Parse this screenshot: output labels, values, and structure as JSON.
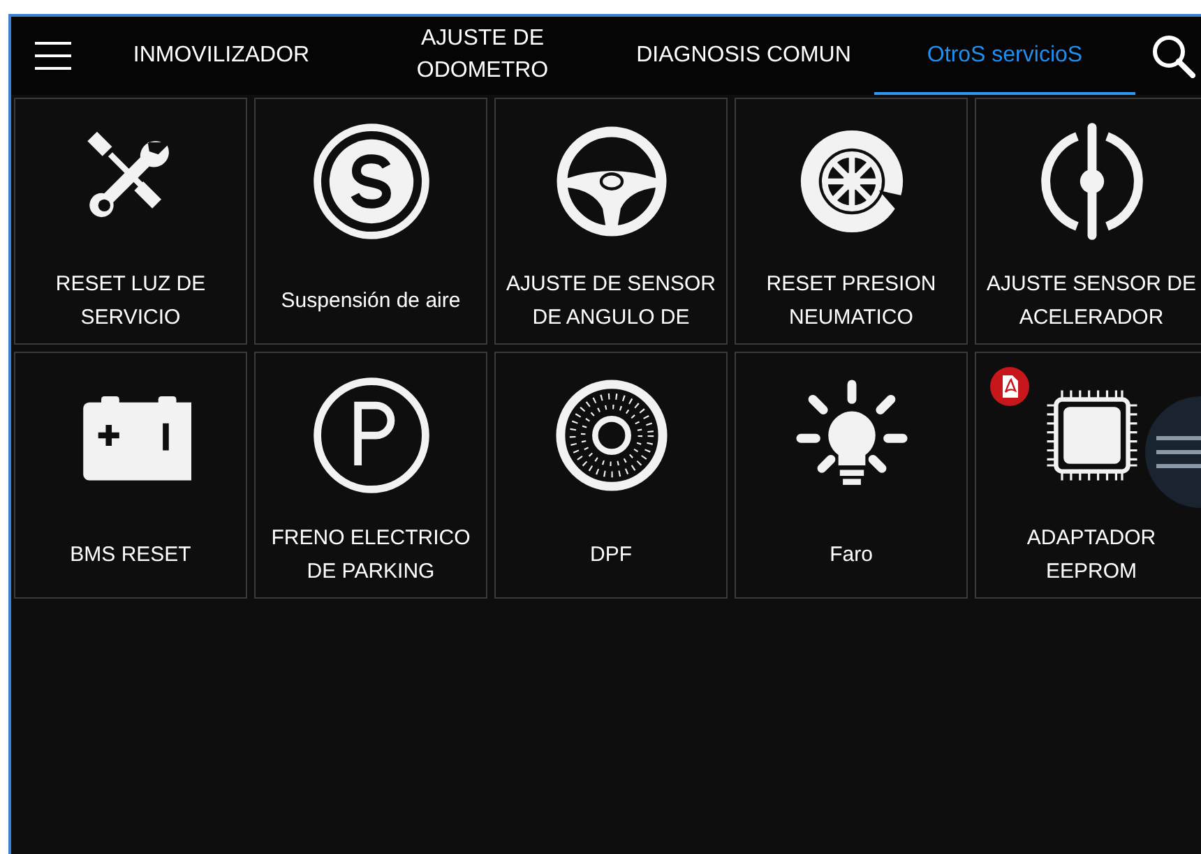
{
  "tabs": [
    {
      "label": "INMOVILIZADOR",
      "selected": false
    },
    {
      "label": "AJUSTE DE ODOMETRO",
      "selected": false
    },
    {
      "label": "DIAGNOSIS COMUN",
      "selected": false
    },
    {
      "label": "OtroS servicioS",
      "selected": true
    }
  ],
  "tiles": [
    {
      "label": "RESET LUZ DE SERVICIO"
    },
    {
      "label": "Suspensión de aire"
    },
    {
      "label": "AJUSTE DE SENSOR DE ANGULO DE"
    },
    {
      "label": "RESET PRESION NEUMATICO"
    },
    {
      "label": "AJUSTE SENSOR DE ACELERADOR"
    },
    {
      "label": "BMS RESET"
    },
    {
      "label": "FRENO ELECTRICO DE PARKING"
    },
    {
      "label": "DPF"
    },
    {
      "label": "Faro"
    },
    {
      "label": "ADAPTADOR EEPROM",
      "pdf_badge": true
    }
  ]
}
